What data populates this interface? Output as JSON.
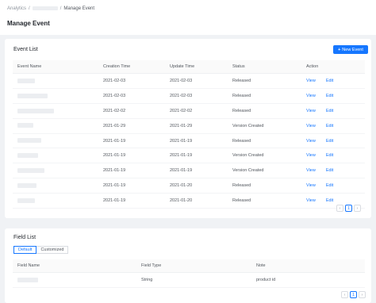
{
  "breadcrumb": {
    "root": "Analytics",
    "separator": "/",
    "current": "Manage Event"
  },
  "page_title": "Manage Event",
  "event_list": {
    "title": "Event List",
    "new_button": "New Event",
    "new_button_icon": "plus-icon",
    "columns": [
      "Event Name",
      "Creation Time",
      "Update Time",
      "Status",
      "Action"
    ],
    "rows": [
      {
        "name_width": 22,
        "created": "2021-02-03",
        "updated": "2021-02-03",
        "status": "Released",
        "view": "View",
        "edit": "Edit"
      },
      {
        "name_width": 38,
        "created": "2021-02-03",
        "updated": "2021-02-03",
        "status": "Released",
        "view": "View",
        "edit": "Edit"
      },
      {
        "name_width": 46,
        "created": "2021-02-02",
        "updated": "2021-02-02",
        "status": "Released",
        "view": "View",
        "edit": "Edit"
      },
      {
        "name_width": 20,
        "created": "2021-01-29",
        "updated": "2021-01-29",
        "status": "Version Created",
        "view": "View",
        "edit": "Edit"
      },
      {
        "name_width": 30,
        "created": "2021-01-19",
        "updated": "2021-01-19",
        "status": "Released",
        "view": "View",
        "edit": "Edit"
      },
      {
        "name_width": 26,
        "created": "2021-01-19",
        "updated": "2021-01-19",
        "status": "Version Created",
        "view": "View",
        "edit": "Edit"
      },
      {
        "name_width": 34,
        "created": "2021-01-19",
        "updated": "2021-01-19",
        "status": "Version Created",
        "view": "View",
        "edit": "Edit"
      },
      {
        "name_width": 24,
        "created": "2021-01-19",
        "updated": "2021-01-20",
        "status": "Released",
        "view": "View",
        "edit": "Edit"
      },
      {
        "name_width": 22,
        "created": "2021-01-19",
        "updated": "2021-01-20",
        "status": "Released",
        "view": "View",
        "edit": "Edit"
      }
    ],
    "pagination": {
      "prev": "‹",
      "page": "1",
      "next": "›"
    }
  },
  "field_list": {
    "title": "Field List",
    "tabs": [
      "Default",
      "Customized"
    ],
    "active_tab": 0,
    "columns": [
      "Field Name",
      "Field Type",
      "Note"
    ],
    "rows": [
      {
        "name_width": 26,
        "type": "String",
        "note": "product id"
      }
    ],
    "pagination": {
      "prev": "‹",
      "page": "1",
      "next": "›"
    }
  },
  "colors": {
    "accent": "#1677ff",
    "background": "#f0f2f5",
    "text": "#1f2329",
    "muted": "#8f959e"
  }
}
